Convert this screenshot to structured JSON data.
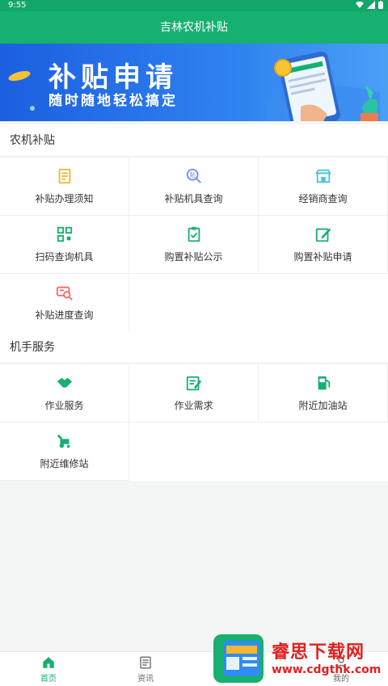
{
  "status": {
    "time": "9:55"
  },
  "app": {
    "title": "吉林农机补贴"
  },
  "banner": {
    "title": "补贴申请",
    "subtitle": "随时随地轻松搞定"
  },
  "sections": {
    "subsidy": {
      "title": "农机补贴",
      "items": [
        {
          "label": "补贴办理须知",
          "icon": "document-icon"
        },
        {
          "label": "补贴机具查询",
          "icon": "subsidy-search-icon"
        },
        {
          "label": "经销商查询",
          "icon": "store-icon"
        },
        {
          "label": "扫码查询机具",
          "icon": "qr-scan-icon"
        },
        {
          "label": "购置补贴公示",
          "icon": "clipboard-icon"
        },
        {
          "label": "购置补贴申请",
          "icon": "edit-icon"
        },
        {
          "label": "补贴进度查询",
          "icon": "progress-search-icon"
        }
      ]
    },
    "operator": {
      "title": "机手服务",
      "items": [
        {
          "label": "作业服务",
          "icon": "handshake-icon"
        },
        {
          "label": "作业需求",
          "icon": "checklist-icon"
        },
        {
          "label": "附近加油站",
          "icon": "gas-station-icon"
        },
        {
          "label": "附近维修站",
          "icon": "tractor-repair-icon"
        }
      ]
    }
  },
  "tabs": [
    {
      "label": "首页",
      "icon": "home-icon",
      "active": true
    },
    {
      "label": "资讯",
      "icon": "news-icon",
      "active": false
    },
    {
      "label": "我的",
      "icon": "user-icon",
      "active": false
    }
  ],
  "watermark": {
    "title": "睿思下载网",
    "url": "www.cdgthk.com"
  },
  "colors": {
    "primary": "#16b071",
    "banner": "#2f82f0"
  }
}
